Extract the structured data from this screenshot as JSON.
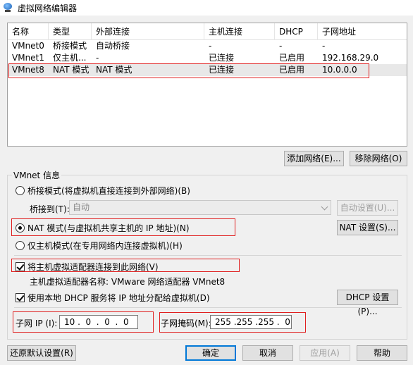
{
  "window": {
    "title": "虚拟网络编辑器"
  },
  "table": {
    "columns": [
      "名称",
      "类型",
      "外部连接",
      "主机连接",
      "DHCP",
      "子网地址"
    ],
    "rows": [
      [
        "VMnet0",
        "桥接模式",
        "自动桥接",
        "-",
        "-",
        "-"
      ],
      [
        "VMnet1",
        "仅主机...",
        "-",
        "已连接",
        "已启用",
        "192.168.29.0"
      ],
      [
        "VMnet8",
        "NAT 模式",
        "NAT 模式",
        "已连接",
        "已启用",
        "10.0.0.0"
      ]
    ]
  },
  "buttons": {
    "add_network": "添加网络(E)...",
    "remove_network": "移除网络(O)",
    "auto_settings": "自动设置(U)...",
    "nat_settings": "NAT 设置(S)...",
    "dhcp_settings": "DHCP 设置(P)...",
    "restore_defaults": "还原默认设置(R)",
    "ok": "确定",
    "cancel": "取消",
    "apply": "应用(A)",
    "help": "帮助"
  },
  "vmnet_info": {
    "label": "VMnet 信息",
    "bridge_mode": "桥接模式(将虚拟机直接连接到外部网络)(B)",
    "bridge_to_label": "桥接到(T):",
    "bridge_to_value": "自动",
    "nat_mode": "NAT 模式(与虚拟机共享主机的 IP 地址)(N)",
    "host_only": "仅主机模式(在专用网络内连接虚拟机)(H)",
    "connect_adapter": "将主机虚拟适配器连接到此网络(V)",
    "adapter_name": "主机虚拟适配器名称: VMware 网络适配器 VMnet8",
    "use_dhcp": "使用本地 DHCP 服务将 IP 地址分配给虚拟机(D)",
    "subnet_ip_label": "子网 IP (I):",
    "subnet_ip_value": "10 .  0  .  0  .  0",
    "subnet_mask_label": "子网掩码(M):",
    "subnet_mask_value": "255 .255 .255 .  0"
  },
  "colors": {
    "highlight_box": "#e02020",
    "selected_row": "#e8e8e8",
    "default_button_border": "#0078d7"
  }
}
